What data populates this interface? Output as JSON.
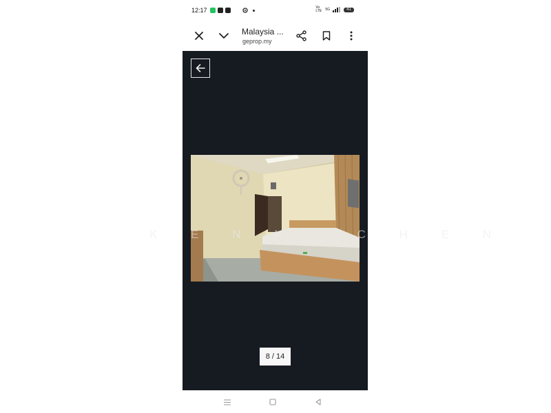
{
  "status_bar": {
    "time": "12:17",
    "app_icon_colors": [
      "#22c55e",
      "#222222",
      "#222222"
    ],
    "network_label": "Vo LTE",
    "signal_label": "5G",
    "battery": "41"
  },
  "browser": {
    "title": "Malaysia ...",
    "domain": "geprop.my"
  },
  "gallery": {
    "counter": "8 / 14",
    "watermark": "K E N N Y   C H E N"
  },
  "colors": {
    "gallery_background": "#161b22",
    "counter_background": "#f7f7f7"
  }
}
